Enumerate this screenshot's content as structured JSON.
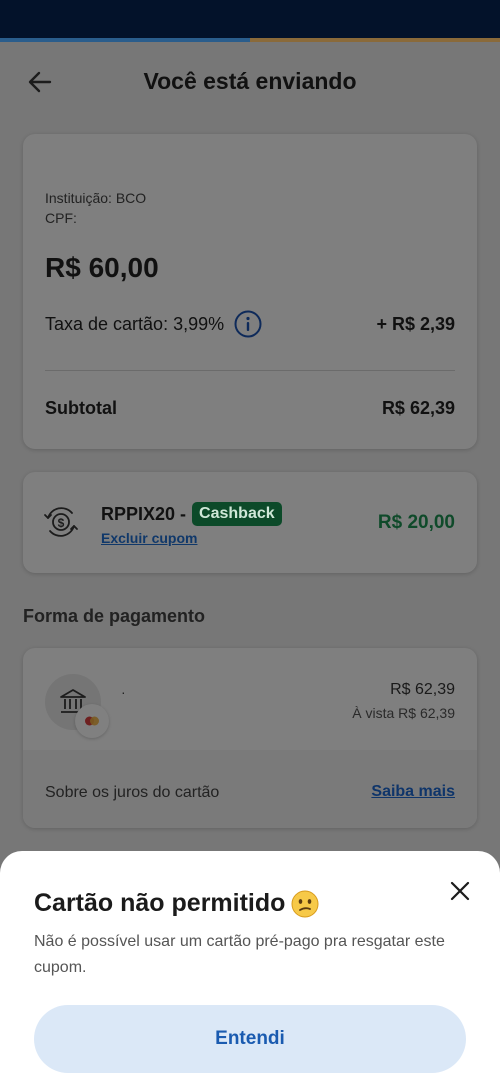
{
  "header": {
    "title": "Você está enviando",
    "back_icon": "arrow-left-icon"
  },
  "summary": {
    "institution": "Instituição: BCO",
    "cpf": "CPF:",
    "amount": "R$ 60,00",
    "fee_label": "Taxa de cartão: 3,99%",
    "fee_value": "+ R$ 2,39",
    "subtotal_label": "Subtotal",
    "subtotal_value": "R$ 62,39"
  },
  "coupon": {
    "code": "RPPIX20 -",
    "badge": "Cashback",
    "remove_label": "Excluir cupom",
    "value": "R$ 20,00",
    "icon": "cashback-exchange-icon"
  },
  "payment": {
    "section_title": "Forma de pagamento",
    "method_name": "·",
    "price": "R$ 62,39",
    "price_sub": "À vista R$ 62,39",
    "juros_label": "Sobre os juros do cartão",
    "juros_link": "Saiba mais",
    "icons": [
      "bank-icon",
      "mastercard-icon"
    ]
  },
  "sheet": {
    "title": "Cartão não permitido",
    "message": "Não é possível usar um cartão pré-pago pra resgatar este cupom.",
    "button": "Entendi",
    "close_icon": "close-icon",
    "emoji_icon": "confused-face-icon"
  },
  "colors": {
    "status_bar": "#03122a",
    "accent_blue": "#1a5bb0",
    "cashback_green": "#0c4a29",
    "button_bg": "#dbe8f7"
  }
}
